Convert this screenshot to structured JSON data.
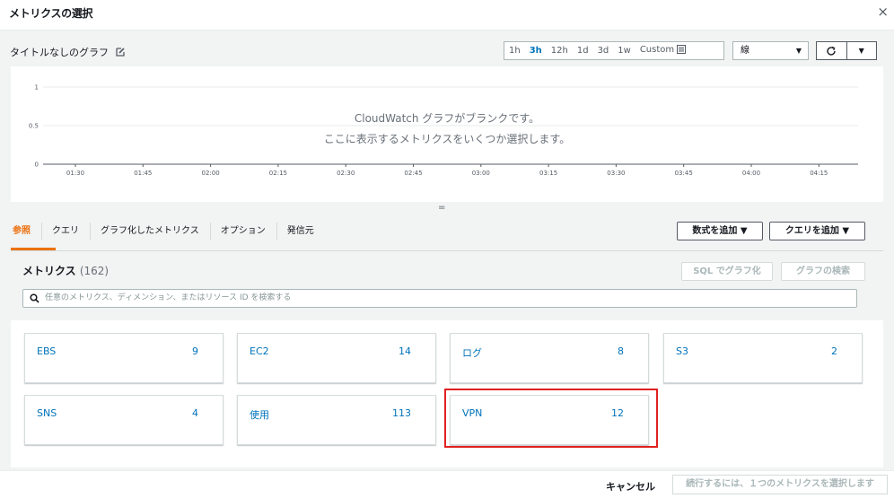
{
  "header": {
    "title": "メトリクスの選択",
    "close": "×"
  },
  "graph": {
    "title": "タイトルなしのグラフ"
  },
  "time_range": {
    "buttons": [
      "1h",
      "3h",
      "12h",
      "1d",
      "3d",
      "1w",
      "Custom"
    ],
    "active": "3h"
  },
  "chart_type_select": {
    "value": "線",
    "caret": "▼"
  },
  "refresh": {
    "icon": "C",
    "menu": "▼"
  },
  "chart_data": {
    "type": "line",
    "y_ticks": [
      "1",
      "0.5",
      "0"
    ],
    "x_ticks": [
      "01:30",
      "01:45",
      "02:00",
      "02:15",
      "02:30",
      "02:45",
      "03:00",
      "03:15",
      "03:30",
      "03:45",
      "04:00",
      "04:15"
    ],
    "series": [],
    "empty_message_line1": "CloudWatch グラフがブランクです。",
    "empty_message_line2": "ここに表示するメトリクスをいくつか選択します。",
    "grid": true
  },
  "resize_handle": "=",
  "tabs": [
    "参照",
    "クエリ",
    "グラフ化したメトリクス",
    "オプション",
    "発信元"
  ],
  "add_math_button": "数式を追加 ▼",
  "add_query_button": "クエリを追加 ▼",
  "metrics": {
    "title": "メトリクス",
    "count": "(162)",
    "sql_button": "SQL でグラフ化",
    "graph_search_button": "グラフの検索",
    "search_placeholder": "任意のメトリクス、ディメンション、またはリソース ID を検索する"
  },
  "namespaces": [
    {
      "name": "EBS",
      "count": "9"
    },
    {
      "name": "EC2",
      "count": "14"
    },
    {
      "name": "ログ",
      "count": "8"
    },
    {
      "name": "S3",
      "count": "2"
    },
    {
      "name": "SNS",
      "count": "4"
    },
    {
      "name": "使用",
      "count": "113"
    },
    {
      "name": "VPN",
      "count": "12"
    }
  ],
  "footer": {
    "cancel": "キャンセル",
    "continue": "続行するには、１つのメトリクスを選択します"
  }
}
